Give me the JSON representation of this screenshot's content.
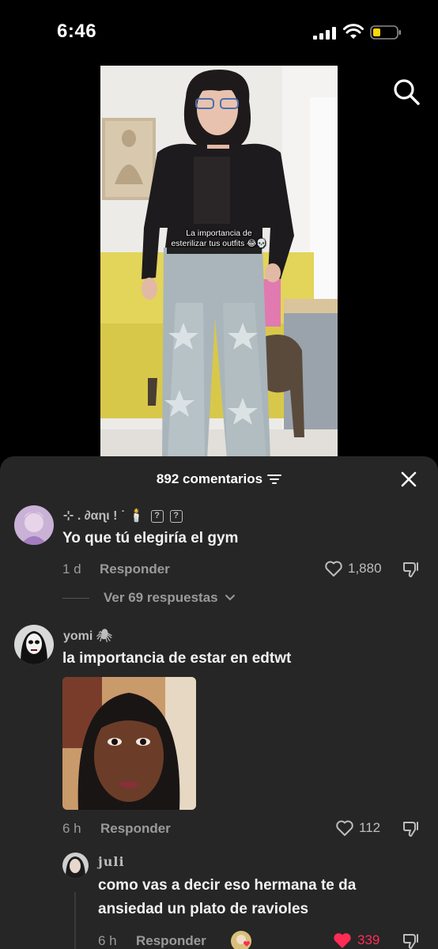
{
  "status_bar": {
    "time": "6:46"
  },
  "video": {
    "overlay_text_line1": "La importancia de",
    "overlay_text_line2": "esterilizar tus outfits 😂💀"
  },
  "sheet": {
    "comments_count": "892 comentarios"
  },
  "comments": [
    {
      "username": "⊹ . ∂αɳι ! ˙ 🕯️",
      "text": "Yo que tú elegiría el gym",
      "time": "1 d",
      "reply_label": "Responder",
      "likes": "1,880",
      "view_replies": "Ver 69 respuestas"
    },
    {
      "username": "yomi 🕷",
      "text": "la importancia de estar en edtwt",
      "time": "6 h",
      "reply_label": "Responder",
      "likes": "112"
    }
  ],
  "reply": {
    "username": "juli",
    "text_line1": "como vas a decir eso hermana te da",
    "text_line2": "ansiedad un plato de ravioles",
    "time": "6 h",
    "reply_label": "Responder",
    "likes": "339",
    "like_color": "#fe2c55"
  },
  "colors": {
    "sheet_bg": "#262626",
    "liked_red": "#fe2c55"
  }
}
